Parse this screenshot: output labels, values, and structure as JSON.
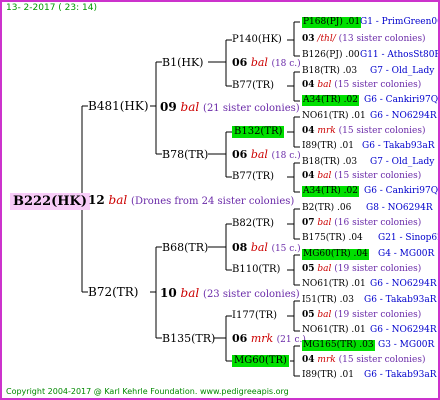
{
  "date": "13- 2-2017 ( 23: 14)",
  "copyright": "Copyright 2004-2017 @ Karl Kehrle Foundation.   www.pedigreeapis.org",
  "root": "B222(HK)",
  "root_info": {
    "num": "12",
    "kind": "bal",
    "text": "(Drones from 24 sister colonies)"
  },
  "sire": {
    "id": "B481(HK)",
    "info": {
      "num": "09",
      "kind": "bal",
      "text": "(21 sister colonies)"
    },
    "top": {
      "id": "B1(HK)",
      "info": {
        "num": "06",
        "kind": "bal",
        "text": "(18 c.)"
      },
      "top": {
        "id": "P140(HK)",
        "info": {
          "num": "03",
          "kind": "/thl/",
          "text": "(13 sister colonies)"
        },
        "top": {
          "id": "P168(PJ) .01",
          "tail": "G1 - PrimGreen00"
        },
        "bot": {
          "id": "B126(PJ) .00",
          "tail": "G11 - AthosSt80R"
        }
      },
      "bot": {
        "id": "B77(TR)",
        "info": {
          "num": "04",
          "kind": "bal",
          "text": "(15 sister colonies)"
        },
        "top": {
          "id": "B18(TR) .03",
          "tail": "G7 - Old_Lady"
        },
        "bot": {
          "id": "A34(TR) .02",
          "tail": "G6 - Cankiri97Q"
        }
      }
    },
    "bot": {
      "id": "B78(TR)",
      "info": {
        "num": "06",
        "kind": "bal",
        "text": "(18 c.)"
      },
      "top": {
        "id": "B132(TR)",
        "info": {
          "num": "04",
          "kind": "mrk",
          "text": "(15 sister colonies)"
        },
        "top": {
          "id": "NO61(TR) .01",
          "tail": "G6 - NO6294R"
        },
        "bot": {
          "id": "I89(TR) .01",
          "tail": "G6 - Takab93aR"
        }
      },
      "bot": {
        "id": "B77(TR)",
        "info": {
          "num": "04",
          "kind": "bal",
          "text": "(15 sister colonies)"
        },
        "top": {
          "id": "B18(TR) .03",
          "tail": "G7 - Old_Lady"
        },
        "bot": {
          "id": "A34(TR) .02",
          "tail": "G6 - Cankiri97Q"
        }
      }
    }
  },
  "dam": {
    "id": "B72(TR)",
    "info": {
      "num": "10",
      "kind": "bal",
      "text": "(23 sister colonies)"
    },
    "top": {
      "id": "B68(TR)",
      "info": {
        "num": "08",
        "kind": "bal",
        "text": "(15 c.)"
      },
      "top": {
        "id": "B82(TR)",
        "info": {
          "num": "07",
          "kind": "bal",
          "text": "(16 sister colonies)"
        },
        "top": {
          "id": "B2(TR) .06",
          "tail": "G8 - NO6294R"
        },
        "bot": {
          "id": "B175(TR) .04",
          "tail": "G21 - Sinop62R"
        }
      },
      "bot": {
        "id": "B110(TR)",
        "info": {
          "num": "05",
          "kind": "bal",
          "text": "(19 sister colonies)"
        },
        "top": {
          "id": "MG60(TR) .04",
          "tail": "G4 - MG00R"
        },
        "bot": {
          "id": "NO61(TR) .01",
          "tail": "G6 - NO6294R"
        }
      }
    },
    "bot": {
      "id": "B135(TR)",
      "info": {
        "num": "06",
        "kind": "mrk",
        "text": "(21 c.)"
      },
      "top": {
        "id": "I177(TR)",
        "info": {
          "num": "05",
          "kind": "bal",
          "text": "(19 sister colonies)"
        },
        "top": {
          "id": "I51(TR) .03",
          "tail": "G6 - Takab93aR"
        },
        "bot": {
          "id": "NO61(TR) .01",
          "tail": "G6 - NO6294R"
        }
      },
      "bot": {
        "id": "MG60(TR)",
        "info": {
          "num": "04",
          "kind": "mrk",
          "text": "(15 sister colonies)"
        },
        "top": {
          "id": "MG165(TR) .03",
          "tail": "G3 - MG00R"
        },
        "bot": {
          "id": "I89(TR) .01",
          "tail": "G6 - Takab93aR"
        }
      }
    }
  },
  "colors": {
    "frame": "#cc33cc",
    "root_bg": "#f8ccf8",
    "highlight": "#00e000",
    "bal": "#cc0000",
    "sister": "#6a2aa8",
    "gen_label": "#0000cc",
    "header": "#009900"
  }
}
